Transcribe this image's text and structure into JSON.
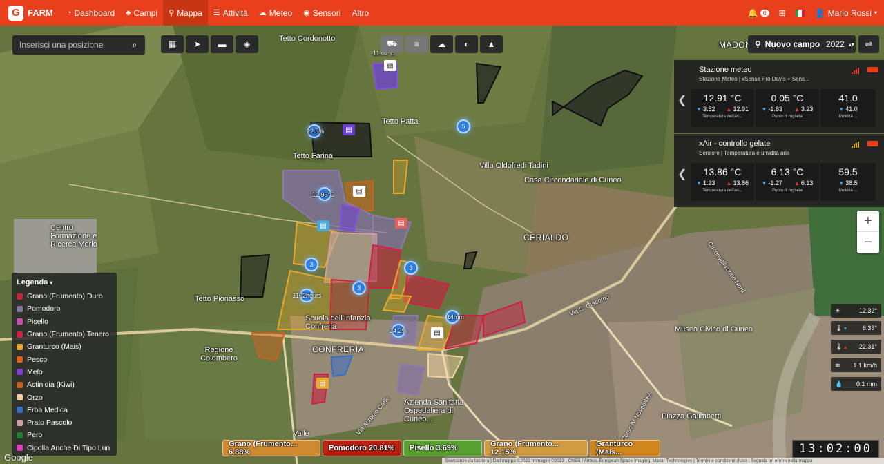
{
  "nav": {
    "brand": "FARM",
    "items": [
      {
        "label": "Dashboard",
        "icon": "dashboard-icon",
        "active": false
      },
      {
        "label": "Campi",
        "icon": "field-icon",
        "active": false
      },
      {
        "label": "Mappa",
        "icon": "map-pin-icon",
        "active": true
      },
      {
        "label": "Attività",
        "icon": "list-icon",
        "active": false
      },
      {
        "label": "Meteo",
        "icon": "cloud-icon",
        "active": false
      },
      {
        "label": "Sensori",
        "icon": "sensor-icon",
        "active": false
      },
      {
        "label": "Altro",
        "icon": "",
        "active": false
      }
    ],
    "notifications": "6",
    "user": "Mario Rossi"
  },
  "search": {
    "placeholder": "Inserisci una posizione"
  },
  "toolbar": {
    "new_field": "Nuovo campo",
    "year": "2022"
  },
  "places": [
    "Tetto Cordonotto",
    "MADONNA DELL'OLMO",
    "Tetto Patta",
    "Tetto Farina",
    "Villa Oldofredi Tadini",
    "Casa Circondariale di Cuneo",
    "Centro Formazione e Ricerca Merlo",
    "CERIALDO",
    "Tetto Pionasso",
    "Scuola dell'Infanzia Confreria",
    "CONFRERIA",
    "Regione Colombero",
    "Museo Civico di Cuneo",
    "Azienda Sanitaria Ospedaliera di Cuneo...",
    "Piazza Galimberti",
    "Circonvallazione Nord",
    "Via S. Giacomo",
    "Via Antonio Carle",
    "Corso IV Novembre",
    "Valle"
  ],
  "map_labels": {
    "l1": "11.62°C",
    "l2": "22.5%",
    "l3": "12.96°C",
    "l4": "3102hours",
    "l5": "24.2%",
    "l6": "14mm",
    "l7": "5",
    "c1": "3",
    "c2": "3",
    "c3": "3"
  },
  "stations": [
    {
      "title": "Stazione meteo",
      "subtitle": "Stazione Meteo | xSense Pro Davis + Sens...",
      "metrics": [
        {
          "value": "12.91 °C",
          "min": "3.52",
          "max": "12.91",
          "label": "Temperatura dell'ari..."
        },
        {
          "value": "0.05 °C",
          "min": "-1.83",
          "max": "3.23",
          "label": "Punto di rugiada"
        },
        {
          "value": "41.0",
          "min": "41.0",
          "max": "",
          "label": "Umidità ..."
        }
      ]
    },
    {
      "title": "xAir - controllo gelate",
      "subtitle": "Sensore | Temperatura e umidità aria",
      "metrics": [
        {
          "value": "13.86 °C",
          "min": "1.23",
          "max": "13.86",
          "label": "Temperatura dell'ari..."
        },
        {
          "value": "6.13 °C",
          "min": "-1.27",
          "max": "6.13",
          "label": "Punto di rugiada"
        },
        {
          "value": "59.5",
          "min": "38.5",
          "max": "",
          "label": "Umidità ..."
        }
      ]
    }
  ],
  "legend": {
    "title": "Legenda",
    "items": [
      {
        "label": "Grano (Frumento) Duro",
        "color": "#c0283a"
      },
      {
        "label": "Pomodoro",
        "color": "#8a7aa0"
      },
      {
        "label": "Pisello",
        "color": "#c850b0"
      },
      {
        "label": "Grano (Frumento) Tenero",
        "color": "#d0204a"
      },
      {
        "label": "Granturco (Mais)",
        "color": "#e8a830"
      },
      {
        "label": "Pesco",
        "color": "#e06020"
      },
      {
        "label": "Melo",
        "color": "#8040d0"
      },
      {
        "label": "Actinidia (Kiwi)",
        "color": "#c86020"
      },
      {
        "label": "Orzo",
        "color": "#f0d0a0"
      },
      {
        "label": "Erba Medica",
        "color": "#3870c0"
      },
      {
        "label": "Prato Pascolo",
        "color": "#d0a0a0"
      },
      {
        "label": "Pero",
        "color": "#208030"
      },
      {
        "label": "Cipolla Anche Di Tipo Lun",
        "color": "#e040c0"
      }
    ]
  },
  "weather": {
    "temp": "12.32°",
    "tmin": "6.33°",
    "tmax": "22.31°",
    "wind": "1.1 km/h",
    "rain": "0.1 mm"
  },
  "crops": [
    {
      "label": "Grano (Frumento... 6.88%",
      "color": "#d08a30"
    },
    {
      "label": "Pomodoro 20.81%",
      "color": "#b82010"
    },
    {
      "label": "Pisello 3.69%",
      "color": "#58a030"
    },
    {
      "label": "Grano (Frumento... 12.15%",
      "color": "#d09a40"
    },
    {
      "label": "Granturco (Mais... ",
      "color": "#d0861c"
    }
  ],
  "clock": "13:02:00",
  "attribution": "Scorciatoie da tastiera  |  Dati mappa ©2023 Immagini ©2023 , CNES / Airbus, European Space Imaging, Maxar Technologies  |  Termini e condizioni d'uso  |  Segnala un errore nella mappa",
  "google": "Google"
}
